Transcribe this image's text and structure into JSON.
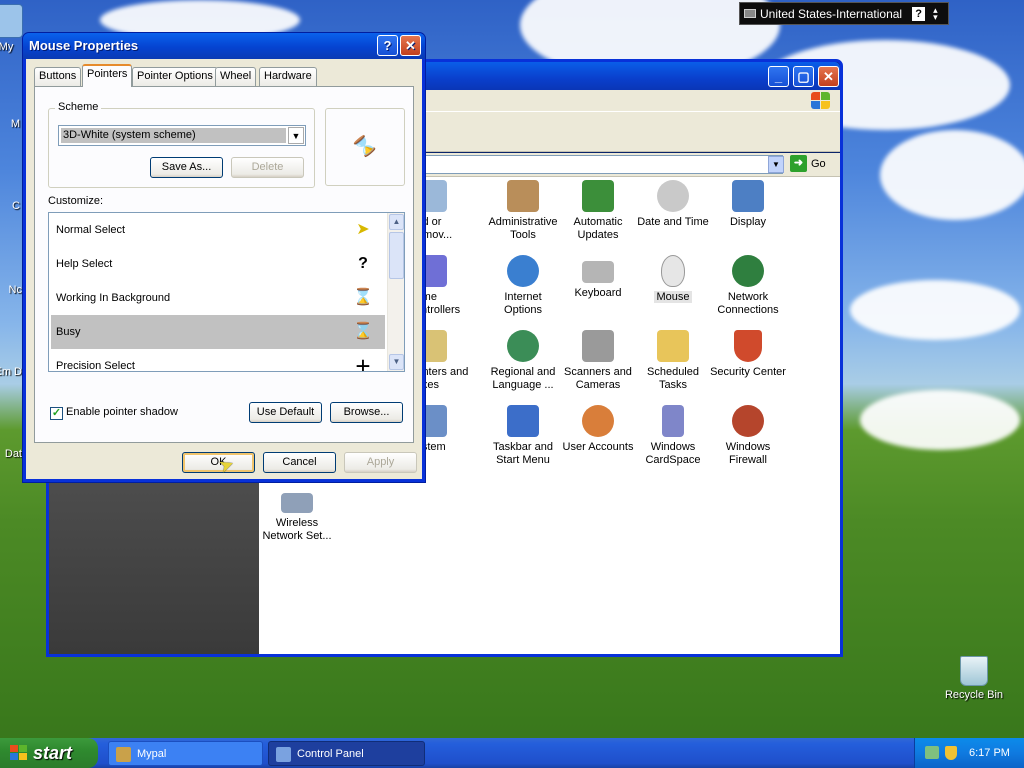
{
  "language_bar": {
    "label": "United States-International",
    "help": "?"
  },
  "desktop_icons": [
    {
      "label": "My",
      "icon": "computer-icon"
    },
    {
      "label": "M",
      "icon": "documents-icon"
    },
    {
      "label": "C",
      "icon": "folder-icon"
    },
    {
      "label": "Nc",
      "icon": "network-icon"
    },
    {
      "label": "Em D",
      "icon": "mail-icon"
    },
    {
      "label": "Dat",
      "icon": "data-icon"
    },
    {
      "label": "Recycle Bin",
      "icon": "recycle-bin-icon"
    }
  ],
  "control_panel": {
    "go_label": "Go",
    "items": [
      {
        "label": "Add or Remov...",
        "icon": "add-remove-icon",
        "color": "#9bb8d9"
      },
      {
        "label": "Administrative Tools",
        "icon": "admin-tools-icon",
        "color": "#b98e5a"
      },
      {
        "label": "Automatic Updates",
        "icon": "windows-flag-icon",
        "color": "#3c8f3a"
      },
      {
        "label": "Date and Time",
        "icon": "clock-icon",
        "color": "#c9c9c9"
      },
      {
        "label": "Display",
        "icon": "display-icon",
        "color": "#4d7fc4"
      },
      {
        "label": "Game Controllers",
        "icon": "gamepad-icon",
        "color": "#6f6fd6"
      },
      {
        "label": "Internet Options",
        "icon": "globe-icon",
        "color": "#3a7fd0"
      },
      {
        "label": "Keyboard",
        "icon": "keyboard-icon",
        "color": "#b5b5b5"
      },
      {
        "label": "Mouse",
        "icon": "mouse-icon",
        "color": "#e6e6e6"
      },
      {
        "label": "Network Connections",
        "icon": "network-icon",
        "color": "#2f7f3f"
      },
      {
        "label": "Printers and Faxes",
        "icon": "printer-icon",
        "color": "#d9c275"
      },
      {
        "label": "Regional and Language ...",
        "icon": "globe-icon",
        "color": "#3b8d57"
      },
      {
        "label": "Scanners and Cameras",
        "icon": "scanner-icon",
        "color": "#9a9a9a"
      },
      {
        "label": "Scheduled Tasks",
        "icon": "folder-clock-icon",
        "color": "#e8c55a"
      },
      {
        "label": "Security Center",
        "icon": "shield-icon",
        "color": "#d04a2c"
      },
      {
        "label": "System",
        "icon": "system-icon",
        "color": "#6b8fc7"
      },
      {
        "label": "Taskbar and Start Menu",
        "icon": "taskbar-icon",
        "color": "#3c6ec9"
      },
      {
        "label": "User Accounts",
        "icon": "users-icon",
        "color": "#d97e3a"
      },
      {
        "label": "Windows CardSpace",
        "icon": "cardspace-icon",
        "color": "#7f86c9"
      },
      {
        "label": "Windows Firewall",
        "icon": "firewall-icon",
        "color": "#b5452c"
      },
      {
        "label": "Wireless Network Set...",
        "icon": "wireless-icon",
        "color": "#8fa0b8"
      }
    ]
  },
  "dialog": {
    "title": "Mouse Properties",
    "help_btn": "?",
    "tabs": [
      "Buttons",
      "Pointers",
      "Pointer Options",
      "Wheel",
      "Hardware"
    ],
    "active_tab": "Pointers",
    "scheme_label": "Scheme",
    "scheme_value": "3D-White (system scheme)",
    "save_as": "Save As...",
    "delete": "Delete",
    "customize_label": "Customize:",
    "pointers": [
      {
        "label": "Normal Select",
        "glyph": "➤",
        "selected": false
      },
      {
        "label": "Help Select",
        "glyph": "?",
        "selected": false
      },
      {
        "label": "Working In Background",
        "glyph": "⌛",
        "selected": false
      },
      {
        "label": "Busy",
        "glyph": "⌛",
        "selected": true
      },
      {
        "label": "Precision Select",
        "glyph": "+",
        "selected": false
      }
    ],
    "enable_shadow_label": "Enable pointer shadow",
    "enable_shadow_checked": true,
    "use_default": "Use Default",
    "browse": "Browse...",
    "ok": "OK",
    "cancel": "Cancel",
    "apply": "Apply"
  },
  "taskbar": {
    "start": "start",
    "apps": [
      {
        "label": "Mypal",
        "active": false
      },
      {
        "label": "Control Panel",
        "active": true
      }
    ],
    "clock": "6:17 PM"
  }
}
